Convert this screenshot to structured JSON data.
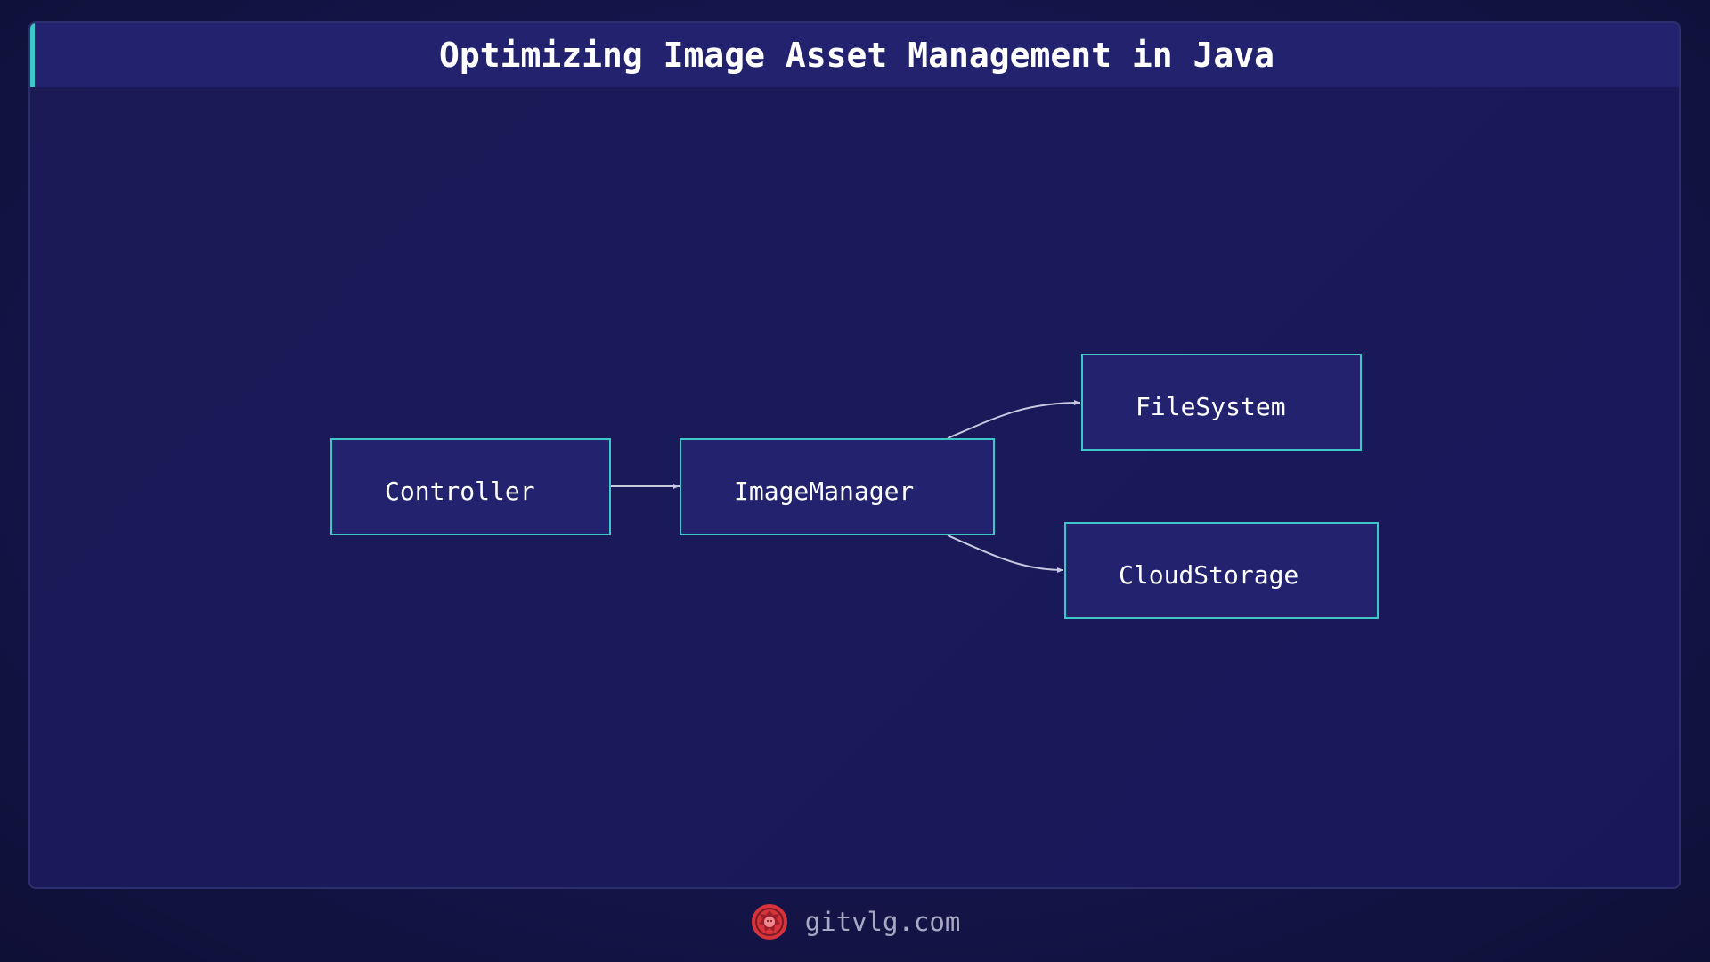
{
  "title": "Optimizing Image Asset Management in Java",
  "diagram": {
    "nodes": [
      {
        "id": "controller",
        "label": "Controller"
      },
      {
        "id": "imagemanager",
        "label": "ImageManager"
      },
      {
        "id": "filesystem",
        "label": "FileSystem"
      },
      {
        "id": "cloudstorage",
        "label": "CloudStorage"
      }
    ],
    "edges": [
      {
        "from": "controller",
        "to": "imagemanager"
      },
      {
        "from": "imagemanager",
        "to": "filesystem"
      },
      {
        "from": "imagemanager",
        "to": "cloudstorage"
      }
    ]
  },
  "footer": {
    "site": "gitvlg.com",
    "logo_icon": "lion-logo-icon"
  },
  "colors": {
    "accent": "#3ec6c9",
    "node_fill": "#22226f",
    "logo": "#d7333c"
  }
}
